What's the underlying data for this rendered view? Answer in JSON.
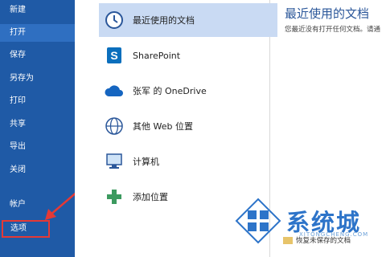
{
  "sidebar": {
    "items": [
      {
        "label": "新建"
      },
      {
        "label": "打开"
      },
      {
        "label": "保存"
      },
      {
        "label": "另存为"
      },
      {
        "label": "打印"
      },
      {
        "label": "共享"
      },
      {
        "label": "导出"
      },
      {
        "label": "关闭"
      },
      {
        "label": "帐户"
      },
      {
        "label": "选项"
      }
    ]
  },
  "locations": {
    "items": [
      {
        "label": "最近使用的文档",
        "icon": "clock-icon"
      },
      {
        "label": "SharePoint",
        "icon": "sharepoint-icon"
      },
      {
        "label": "张军 的 OneDrive",
        "icon": "onedrive-cloud-icon"
      },
      {
        "label": "其他 Web 位置",
        "icon": "globe-icon"
      },
      {
        "label": "计算机",
        "icon": "computer-icon"
      },
      {
        "label": "添加位置",
        "icon": "plus-icon"
      }
    ]
  },
  "right": {
    "title": "最近使用的文档",
    "subtitle": "您最近没有打开任何文档。请通"
  },
  "recover": {
    "label": "恢复未保存的文档"
  },
  "watermark": {
    "text": "系统城",
    "sub": "XITONGCHENG.COM"
  },
  "colors": {
    "sidebar": "#1f5aa6",
    "selected_nav": "#2f6fc1",
    "selected_location": "#c9daf3",
    "annotation": "#e53935"
  }
}
